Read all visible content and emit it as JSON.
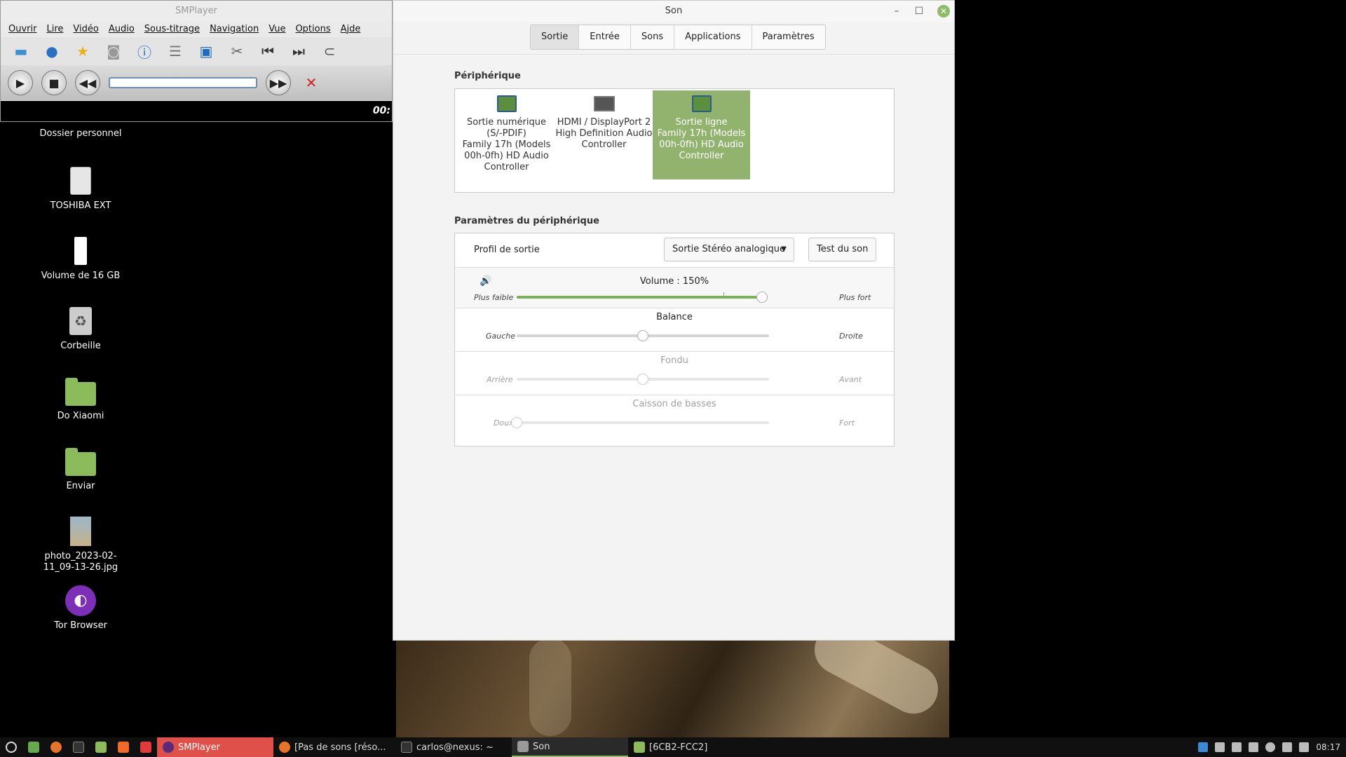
{
  "desktop": {
    "icons": [
      {
        "label": "Dossier personnel",
        "icon": "home-folder-icon"
      },
      {
        "label": "TOSHIBA EXT",
        "icon": "drive-icon"
      },
      {
        "label": "Volume de 16 GB",
        "icon": "usb-drive-icon"
      },
      {
        "label": "Corbeille",
        "icon": "trash-icon"
      },
      {
        "label": "Do Xiaomi",
        "icon": "folder-icon"
      },
      {
        "label": "Enviar",
        "icon": "folder-icon"
      },
      {
        "label": "photo_2023-02-11_09-13-26.jpg",
        "icon": "image-file-icon"
      },
      {
        "label": "Tor Browser",
        "icon": "tor-browser-icon"
      }
    ]
  },
  "smplayer": {
    "title": "SMPlayer",
    "menu": [
      "Ouvrir",
      "Lire",
      "Vidéo",
      "Audio",
      "Sous-titrage",
      "Navigation",
      "Vue",
      "Options",
      "Ajde"
    ],
    "time": "00:"
  },
  "son": {
    "title": "Son",
    "tabs": [
      "Sortie",
      "Entrée",
      "Sons",
      "Applications",
      "Paramètres"
    ],
    "active_tab": "Sortie",
    "device_section": "Périphérique",
    "devices": [
      {
        "name": "Sortie numérique (S/-PDIF)",
        "detail": "Family 17h (Models 00h-0fh) HD Audio Controller"
      },
      {
        "name": "HDMI / DisplayPort 2",
        "detail": "High Definition Audio Controller"
      },
      {
        "name": "Sortie ligne",
        "detail": "Family 17h (Models 00h-0fh) HD Audio Controller",
        "selected": true
      }
    ],
    "settings_section": "Paramètres du périphérique",
    "profile_label": "Profil de sortie",
    "profile_value": "Sortie Stéréo analogique",
    "test_button": "Test du son",
    "volume": {
      "label": "Volume : 150%",
      "min_label": "Plus faible",
      "max_label": "Plus fort",
      "level": 1.0
    },
    "balance": {
      "label": "Balance",
      "left": "Gauche",
      "right": "Droite",
      "level": 0.5
    },
    "fade": {
      "label": "Fondu",
      "left": "Arrière",
      "right": "Avant",
      "level": 0.5
    },
    "subwoofer": {
      "label": "Caisson de basses",
      "left": "Doux",
      "right": "Fort",
      "level": 0.0
    }
  },
  "taskbar": {
    "apps": [
      {
        "label": "SMPlayer",
        "color": "#e0504a"
      },
      {
        "label": "[Pas de sons [réso..."
      },
      {
        "label": "carlos@nexus: ~"
      },
      {
        "label": "Son"
      },
      {
        "label": "[6CB2-FCC2]"
      }
    ],
    "clock": "08:17"
  },
  "colors": {
    "accent": "#92b36e",
    "slider_fill": "#7bb157"
  }
}
